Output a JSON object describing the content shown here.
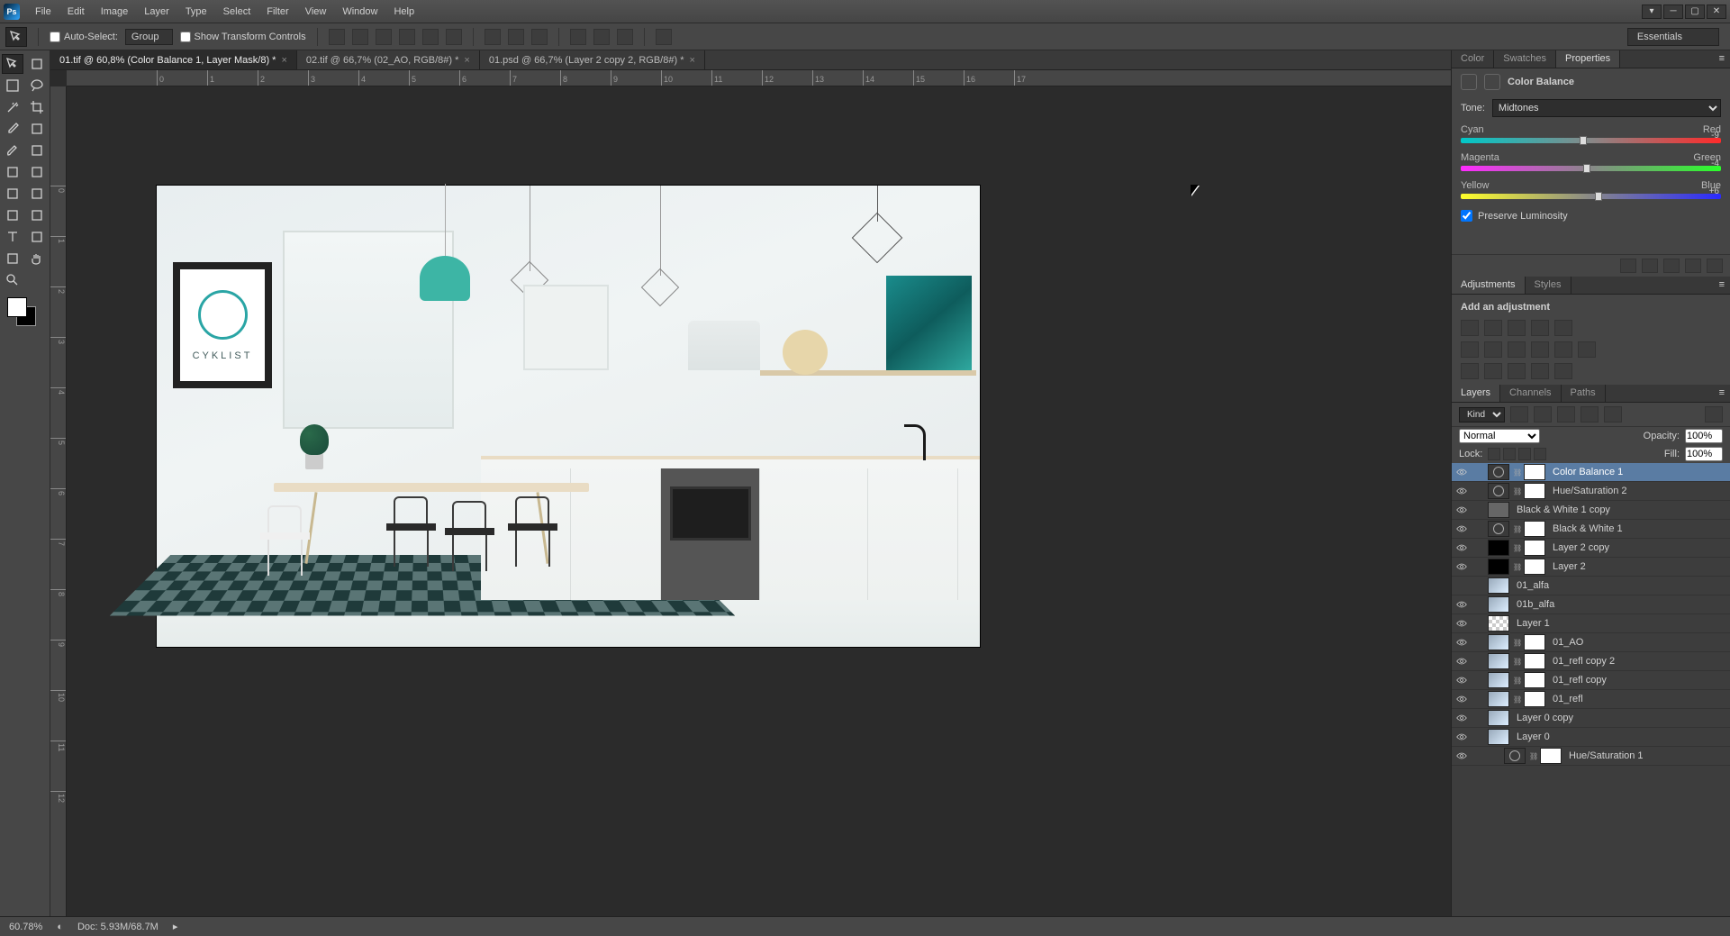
{
  "menubar": {
    "items": [
      "File",
      "Edit",
      "Image",
      "Layer",
      "Type",
      "Select",
      "Filter",
      "View",
      "Window",
      "Help"
    ]
  },
  "optionsbar": {
    "auto_select": "Auto-Select:",
    "group": "Group",
    "show_tc": "Show Transform Controls"
  },
  "workspace": "Essentials",
  "tabs": [
    {
      "label": "01.tif @ 60,8% (Color Balance 1, Layer Mask/8) *",
      "active": true
    },
    {
      "label": "02.tif @ 66,7% (02_AO, RGB/8#) *",
      "active": false
    },
    {
      "label": "01.psd @ 66,7% (Layer 2 copy 2, RGB/8#) *",
      "active": false
    }
  ],
  "ruler_h": [
    "0",
    "1",
    "2",
    "3",
    "4",
    "5",
    "6",
    "7",
    "8",
    "9",
    "10",
    "11",
    "12",
    "13",
    "14",
    "15",
    "16",
    "17"
  ],
  "ruler_v": [
    "0",
    "1",
    "2",
    "3",
    "4",
    "5",
    "6",
    "7",
    "8",
    "9",
    "10",
    "11",
    "12"
  ],
  "frame_text": "CYKLIST",
  "panel1": {
    "tabs": [
      "Color",
      "Swatches",
      "Properties"
    ],
    "active": 2
  },
  "properties": {
    "title": "Color Balance",
    "tone_label": "Tone:",
    "tone_value": "Midtones",
    "sliders": [
      {
        "left": "Cyan",
        "right": "Red",
        "value": "-9",
        "pos": 47
      },
      {
        "left": "Magenta",
        "right": "Green",
        "value": "-4",
        "pos": 48.5
      },
      {
        "left": "Yellow",
        "right": "Blue",
        "value": "+6",
        "pos": 53
      }
    ],
    "preserve": "Preserve Luminosity"
  },
  "panel2": {
    "tabs": [
      "Adjustments",
      "Styles"
    ],
    "active": 0,
    "title": "Add an adjustment"
  },
  "panel3": {
    "tabs": [
      "Layers",
      "Channels",
      "Paths"
    ],
    "active": 0
  },
  "layer_opts": {
    "kind": "Kind",
    "blend": "Normal",
    "opacity_label": "Opacity:",
    "opacity": "100%",
    "lock_label": "Lock:",
    "fill_label": "Fill:",
    "fill": "100%"
  },
  "layers": [
    {
      "name": "Color Balance 1",
      "vis": true,
      "adj": true,
      "mask": "white",
      "selected": true
    },
    {
      "name": "Hue/Saturation 2",
      "vis": true,
      "adj": true,
      "mask": "white"
    },
    {
      "name": "Black & White 1 copy",
      "vis": true,
      "adj": false,
      "plain": true
    },
    {
      "name": "Black & White 1",
      "vis": true,
      "adj": true,
      "mask": "white"
    },
    {
      "name": "Layer 2 copy",
      "vis": true,
      "adj": false,
      "mask": "white",
      "thumb": "black"
    },
    {
      "name": "Layer 2",
      "vis": true,
      "adj": false,
      "mask": "white",
      "thumb": "black"
    },
    {
      "name": "01_alfa",
      "vis": false,
      "adj": false,
      "thumb": "img"
    },
    {
      "name": "01b_alfa",
      "vis": true,
      "adj": false,
      "thumb": "img"
    },
    {
      "name": "Layer 1",
      "vis": true,
      "adj": false,
      "thumb": "checker"
    },
    {
      "name": "01_AO",
      "vis": true,
      "adj": false,
      "mask": "white",
      "thumb": "img"
    },
    {
      "name": "01_refl copy 2",
      "vis": true,
      "adj": false,
      "mask": "white",
      "thumb": "img"
    },
    {
      "name": "01_refl copy",
      "vis": true,
      "adj": false,
      "mask": "white",
      "thumb": "img"
    },
    {
      "name": "01_refl",
      "vis": true,
      "adj": false,
      "mask": "white",
      "thumb": "img"
    },
    {
      "name": "Layer 0 copy",
      "vis": true,
      "adj": false,
      "thumb": "img"
    },
    {
      "name": "Layer 0",
      "vis": true,
      "adj": false,
      "thumb": "img"
    },
    {
      "name": "Hue/Saturation 1",
      "vis": true,
      "adj": true,
      "mask": "white",
      "indent": true
    }
  ],
  "statusbar": {
    "zoom": "60.78%",
    "doc": "Doc: 5.93M/68.7M"
  }
}
